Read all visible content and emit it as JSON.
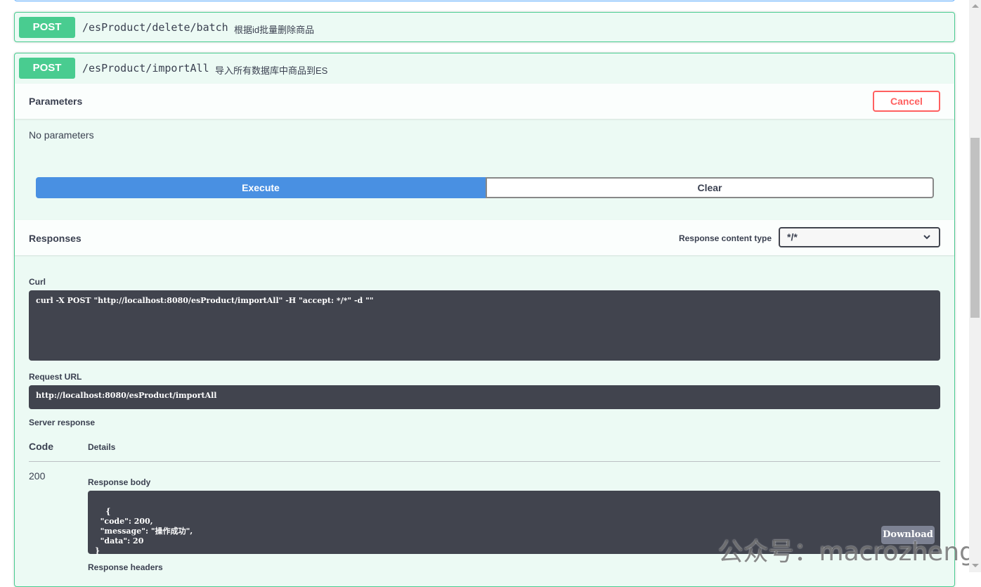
{
  "endpoints": [
    {
      "method": "POST",
      "path": "/esProduct/delete/batch",
      "description": "根据id批量删除商品"
    },
    {
      "method": "POST",
      "path": "/esProduct/importAll",
      "description": "导入所有数据库中商品到ES"
    }
  ],
  "parameters": {
    "title": "Parameters",
    "cancel_label": "Cancel",
    "empty_text": "No parameters"
  },
  "actions": {
    "execute_label": "Execute",
    "clear_label": "Clear"
  },
  "responses": {
    "title": "Responses",
    "content_type_label": "Response content type",
    "content_type_value": "*/*"
  },
  "curl": {
    "label": "Curl",
    "command": "curl -X POST \"http://localhost:8080/esProduct/importAll\" -H \"accept: */*\" -d \"\""
  },
  "request_url": {
    "label": "Request URL",
    "value": "http://localhost:8080/esProduct/importAll"
  },
  "server_response": {
    "label": "Server response",
    "code_header": "Code",
    "details_header": "Details",
    "code": "200",
    "body_label": "Response body",
    "body": "{\n  \"code\": 200,\n  \"message\": \"操作成功\",\n  \"data\": 20\n}",
    "download_label": "Download",
    "headers_label": "Response headers"
  },
  "watermark": "公众号：macrozheng",
  "colors": {
    "post": "#49cc90",
    "execute": "#4990e2",
    "cancel": "#ff6060",
    "code_bg": "#41444e"
  }
}
